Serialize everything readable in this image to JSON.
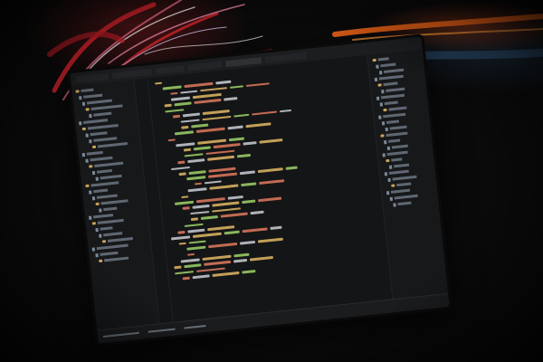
{
  "scene": {
    "description_tag": "photo-of-code-editor-on-monitor",
    "colors": {
      "background": "#0b0b0c",
      "trail_red": "#e2262e",
      "trail_pink": "#f06a8a",
      "trail_white": "#f3e9f0",
      "trail_orange": "#ff6a1a",
      "editor_bg": "#141516",
      "code_tag": "#e2b865",
      "code_attr": "#9fd26a",
      "code_string": "#e07a5f",
      "code_plain": "#c9ced6"
    }
  },
  "editor": {
    "tabs": [],
    "status": []
  },
  "trees": {
    "left_count": 28,
    "right_count": 24
  }
}
